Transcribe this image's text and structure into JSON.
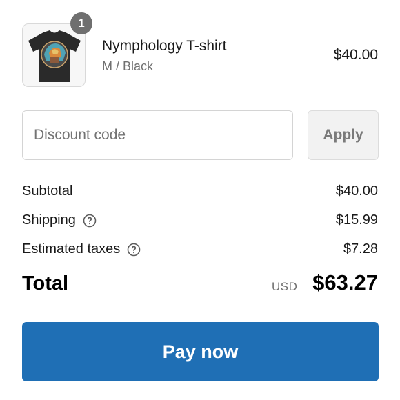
{
  "product": {
    "quantity": "1",
    "title": "Nymphology T-shirt",
    "variant": "M / Black",
    "price": "$40.00",
    "image_icon": "tshirt-thumbnail"
  },
  "discount": {
    "placeholder": "Discount code",
    "apply_label": "Apply"
  },
  "summary": {
    "subtotal_label": "Subtotal",
    "subtotal_value": "$40.00",
    "shipping_label": "Shipping",
    "shipping_value": "$15.99",
    "taxes_label": "Estimated taxes",
    "taxes_value": "$7.28",
    "help_icon": "question-circle-icon"
  },
  "total": {
    "label": "Total",
    "currency": "USD",
    "value": "$63.27"
  },
  "pay": {
    "label": "Pay now"
  },
  "colors": {
    "accent": "#1f6fb5",
    "badge": "#6f6f6f",
    "muted_text": "#707070"
  }
}
